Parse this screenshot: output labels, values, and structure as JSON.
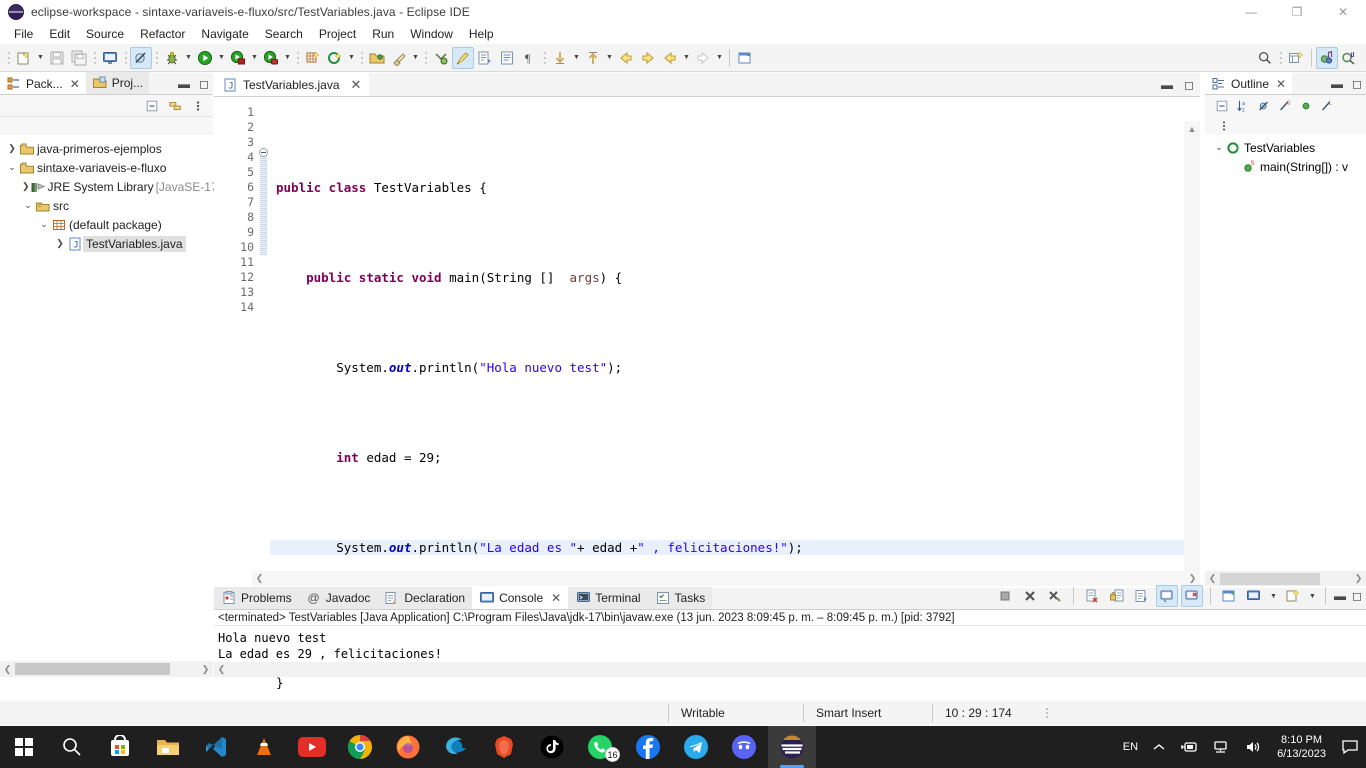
{
  "window": {
    "title": "eclipse-workspace - sintaxe-variaveis-e-fluxo/src/TestVariables.java - Eclipse IDE",
    "minimize": "—",
    "maximize": "❐",
    "close": "✕",
    "app_icon": "eclipse-sphere-icon"
  },
  "menubar": {
    "items": [
      "File",
      "Edit",
      "Source",
      "Refactor",
      "Navigate",
      "Search",
      "Project",
      "Run",
      "Window",
      "Help"
    ]
  },
  "toolbar": {
    "groups": [
      {
        "items": [
          {
            "name": "new-wizard-icon",
            "glyph": "📄",
            "dropdown": true,
            "selected": false
          },
          {
            "name": "save-icon",
            "glyph": "💾",
            "dropdown": false,
            "selected": false
          },
          {
            "name": "save-all-icon",
            "glyph": "🗎",
            "dropdown": false,
            "selected": false
          }
        ]
      },
      {
        "items": [
          {
            "name": "open-console-icon",
            "glyph": "🖥",
            "dropdown": false,
            "selected": false
          }
        ]
      },
      {
        "items": [
          {
            "name": "skip-all-breakpoints-icon",
            "glyph": "⊘",
            "dropdown": false,
            "selected": true
          }
        ]
      },
      {
        "items": [
          {
            "name": "debug-icon",
            "glyph": "🐞",
            "dropdown": true,
            "selected": false
          },
          {
            "name": "run-icon",
            "glyph": "▶",
            "dropdown": true,
            "selected": false
          },
          {
            "name": "coverage-icon",
            "glyph": "◉",
            "dropdown": true,
            "selected": false
          },
          {
            "name": "profile-icon",
            "glyph": "◉",
            "dropdown": true,
            "selected": false
          }
        ]
      },
      {
        "items": [
          {
            "name": "new-java-package-icon",
            "glyph": "▦",
            "dropdown": false,
            "selected": false
          },
          {
            "name": "new-java-class-icon",
            "glyph": "C",
            "dropdown": true,
            "selected": false
          }
        ]
      },
      {
        "items": [
          {
            "name": "open-type-icon",
            "glyph": "📂",
            "dropdown": false,
            "selected": false
          },
          {
            "name": "search-ref-icon",
            "glyph": "🔧",
            "dropdown": true,
            "selected": false
          }
        ]
      },
      {
        "items": [
          {
            "name": "previous-annotation-icon",
            "glyph": "⇩",
            "dropdown": false,
            "selected": false
          },
          {
            "name": "toggle-mark-occurrences-icon",
            "glyph": "🖌",
            "dropdown": false,
            "selected": true
          },
          {
            "name": "toggle-block-selection-icon",
            "glyph": "▤",
            "dropdown": false,
            "selected": false
          },
          {
            "name": "show-whitespace-icon",
            "glyph": "▥",
            "dropdown": false,
            "selected": false
          },
          {
            "name": "pilcrow-icon",
            "glyph": "¶",
            "dropdown": false,
            "selected": false
          }
        ]
      },
      {
        "items": [
          {
            "name": "next-annotation-icon",
            "glyph": "⇓",
            "dropdown": true,
            "selected": false
          },
          {
            "name": "prev-annotation-icon",
            "glyph": "⇑",
            "dropdown": true,
            "selected": false
          },
          {
            "name": "back-arrow-icon",
            "glyph": "⇦",
            "dropdown": false,
            "selected": false
          },
          {
            "name": "forward-arrow-icon",
            "glyph": "⇨",
            "dropdown": false,
            "selected": false
          },
          {
            "name": "back-history-icon",
            "glyph": "⇦",
            "dropdown": true,
            "selected": false
          },
          {
            "name": "forward-history-icon",
            "glyph": "⇨",
            "dropdown": true,
            "selected": false
          }
        ]
      },
      {
        "items": [
          {
            "name": "pin-editor-icon",
            "glyph": "🗗",
            "dropdown": false,
            "selected": false
          }
        ]
      }
    ],
    "right": [
      {
        "name": "quick-access-search-icon",
        "glyph": "🔍"
      },
      {
        "name": "open-perspective-icon",
        "glyph": "🗔"
      },
      {
        "name": "java-perspective-icon",
        "glyph": "J",
        "selected": true
      },
      {
        "name": "debug-perspective-icon",
        "glyph": "D",
        "selected": false
      }
    ]
  },
  "package_explorer": {
    "tabs": [
      {
        "label": "Pack...",
        "icon": "package-explorer-icon",
        "active": true,
        "closable": true
      },
      {
        "label": "Proj...",
        "icon": "project-explorer-icon",
        "active": false,
        "closable": false
      }
    ],
    "minimize": "▬",
    "maximize": "◻",
    "view_buttons": [
      {
        "name": "collapse-all-icon",
        "glyph": "⊟"
      },
      {
        "name": "link-with-editor-icon",
        "glyph": "⇄"
      },
      {
        "name": "view-menu-icon",
        "glyph": "⋮"
      }
    ],
    "tree": [
      {
        "indent": 0,
        "twisty": "collapsed",
        "icon": "project-folder-icon",
        "label": "java-primeros-ejemplos",
        "suffix": "",
        "selected": false
      },
      {
        "indent": 0,
        "twisty": "expanded",
        "icon": "project-folder-icon",
        "label": "sintaxe-variaveis-e-fluxo",
        "suffix": "",
        "selected": false
      },
      {
        "indent": 1,
        "twisty": "collapsed",
        "icon": "jre-library-icon",
        "label": "JRE System Library",
        "suffix": "[JavaSE-17",
        "selected": false
      },
      {
        "indent": 1,
        "twisty": "expanded",
        "icon": "source-folder-icon",
        "label": "src",
        "suffix": "",
        "selected": false
      },
      {
        "indent": 2,
        "twisty": "expanded",
        "icon": "package-icon",
        "label": "(default package)",
        "suffix": "",
        "selected": false
      },
      {
        "indent": 3,
        "twisty": "collapsed",
        "icon": "java-file-icon",
        "label": "TestVariables.java",
        "suffix": "",
        "selected": true
      }
    ],
    "hscroll": {
      "left_arrow": "❮",
      "right_arrow": "❯"
    }
  },
  "editor": {
    "tab": {
      "label": "TestVariables.java",
      "icon": "java-file-icon",
      "close": "✕"
    },
    "minimize": "▬",
    "maximize": "◻",
    "line_numbers": [
      "1",
      "2",
      "3",
      "4",
      "5",
      "6",
      "7",
      "8",
      "9",
      "10",
      "11",
      "12",
      "13",
      "14"
    ],
    "lines": [
      {
        "n": 1,
        "html": "",
        "highlight": false
      },
      {
        "n": 2,
        "html": "<span class='kw'>public class</span> TestVariables {",
        "highlight": false
      },
      {
        "n": 3,
        "html": "",
        "highlight": false
      },
      {
        "n": 4,
        "html": "    <span class='kw'>public static void</span> main(String []  <span class='par'>args</span>) {",
        "highlight": false
      },
      {
        "n": 5,
        "html": "",
        "highlight": false
      },
      {
        "n": 6,
        "html": "        System.<span class='fld'>out</span>.println(<span class='str'>\"Hola nuevo test\"</span>);",
        "highlight": false
      },
      {
        "n": 7,
        "html": "",
        "highlight": false
      },
      {
        "n": 8,
        "html": "        <span class='kw'>int</span> edad = 29;",
        "highlight": false
      },
      {
        "n": 9,
        "html": "",
        "highlight": false
      },
      {
        "n": 10,
        "html": "        System.<span class='fld'>out</span>.println(<span class='str'>\"La edad es \"</span>+ edad +<span class='str'>\" , felicitaciones!\"</span>);",
        "highlight": true
      },
      {
        "n": 11,
        "html": "    }",
        "highlight": false
      },
      {
        "n": 12,
        "html": "",
        "highlight": false
      },
      {
        "n": 13,
        "html": "}",
        "highlight": false
      },
      {
        "n": 14,
        "html": "",
        "highlight": false
      }
    ],
    "plain_text": "public class TestVariables {\n\n    public static void main(String []  args) {\n\n        System.out.println(\"Hola nuevo test\");\n\n        int edad = 29;\n\n        System.out.println(\"La edad es \"+ edad +\" , felicitaciones!\");\n    }\n\n}"
  },
  "outline": {
    "title": "Outline",
    "close": "✕",
    "minimize": "▬",
    "maximize": "◻",
    "toolbar": [
      {
        "name": "collapse-all-icon",
        "glyph": "⊟"
      },
      {
        "name": "sort-alphabetically-icon",
        "glyph": "↓ᵃz"
      },
      {
        "name": "hide-fields-icon",
        "glyph": "⊘"
      },
      {
        "name": "hide-static-icon",
        "glyph": "⊘ˢ"
      },
      {
        "name": "hide-nonpublic-icon",
        "glyph": "●"
      },
      {
        "name": "hide-local-types-icon",
        "glyph": "⊘ᴸ"
      },
      {
        "name": "view-menu-icon",
        "glyph": "⋮"
      }
    ],
    "tree": [
      {
        "indent": 0,
        "twisty": "expanded",
        "icon": "java-class-icon",
        "label": "TestVariables"
      },
      {
        "indent": 1,
        "twisty": "none",
        "icon": "public-method-icon",
        "label": "main(String[]) : v"
      }
    ]
  },
  "console": {
    "tabs": [
      {
        "label": "Problems",
        "icon": "problems-icon",
        "active": false,
        "closable": false
      },
      {
        "label": "Javadoc",
        "icon": "javadoc-icon",
        "active": false,
        "closable": false
      },
      {
        "label": "Declaration",
        "icon": "declaration-icon",
        "active": false,
        "closable": false
      },
      {
        "label": "Console",
        "icon": "console-icon",
        "active": true,
        "closable": true
      },
      {
        "label": "Terminal",
        "icon": "terminal-icon",
        "active": false,
        "closable": false
      },
      {
        "label": "Tasks",
        "icon": "tasks-icon",
        "active": false,
        "closable": false
      }
    ],
    "toolbar": [
      {
        "name": "terminate-icon",
        "glyph": "■",
        "selected": false
      },
      {
        "name": "remove-launch-icon",
        "glyph": "✖",
        "selected": false
      },
      {
        "name": "remove-all-terminated-icon",
        "glyph": "✖",
        "selected": false
      },
      {
        "name": "clear-console-icon",
        "glyph": "🗋",
        "selected": false
      },
      {
        "name": "scroll-lock-icon",
        "glyph": "🔒",
        "selected": false
      },
      {
        "name": "word-wrap-icon",
        "glyph": "🗎",
        "selected": false
      },
      {
        "name": "show-console-on-output-icon",
        "glyph": "🖵",
        "selected": true
      },
      {
        "name": "show-console-on-error-icon",
        "glyph": "🖵",
        "selected": true
      },
      {
        "name": "pin-console-icon",
        "glyph": "📌",
        "selected": false
      },
      {
        "name": "display-selected-console-icon",
        "glyph": "🖥",
        "selected": false,
        "dropdown": true
      },
      {
        "name": "open-console-icon",
        "glyph": "🗋",
        "selected": false,
        "dropdown": true
      },
      {
        "name": "minimize-icon",
        "glyph": "▬",
        "selected": false
      },
      {
        "name": "maximize-icon",
        "glyph": "◻",
        "selected": false
      }
    ],
    "header": "<terminated> TestVariables [Java Application] C:\\Program Files\\Java\\jdk-17\\bin\\javaw.exe  (13 jun. 2023 8:09:45 p. m. – 8:09:45 p. m.) [pid: 3792]",
    "output_lines": [
      "Hola nuevo test",
      "La edad es 29 , felicitaciones!"
    ]
  },
  "statusbar": {
    "writable": "Writable",
    "insert_mode": "Smart Insert",
    "position": "10 : 29 : 174"
  },
  "taskbar": {
    "items": [
      {
        "name": "start-button-icon",
        "glyph": "⊞",
        "active": false,
        "badge": null
      },
      {
        "name": "search-icon",
        "glyph": "🔍",
        "active": false,
        "badge": null
      },
      {
        "name": "microsoft-store-icon",
        "glyph": "🛍",
        "active": false,
        "badge": null
      },
      {
        "name": "file-explorer-icon",
        "glyph": "📁",
        "active": false,
        "badge": null
      },
      {
        "name": "vscode-icon",
        "glyph": "X",
        "active": false,
        "badge": null
      },
      {
        "name": "vlc-icon",
        "glyph": "▲",
        "active": false,
        "badge": null
      },
      {
        "name": "youtube-icon",
        "glyph": "▶",
        "active": false,
        "badge": null
      },
      {
        "name": "chrome-icon",
        "glyph": "◉",
        "active": false,
        "badge": null
      },
      {
        "name": "firefox-icon",
        "glyph": "🦊",
        "active": false,
        "badge": null
      },
      {
        "name": "edge-icon",
        "glyph": "◉",
        "active": false,
        "badge": null
      },
      {
        "name": "brave-icon",
        "glyph": "🦁",
        "active": false,
        "badge": null
      },
      {
        "name": "tiktok-icon",
        "glyph": "♪",
        "active": false,
        "badge": null
      },
      {
        "name": "whatsapp-icon",
        "glyph": "✆",
        "active": false,
        "badge": "16"
      },
      {
        "name": "facebook-icon",
        "glyph": "f",
        "active": false,
        "badge": null
      },
      {
        "name": "telegram-icon",
        "glyph": "➤",
        "active": false,
        "badge": null
      },
      {
        "name": "discord-icon",
        "glyph": "◕",
        "active": false,
        "badge": null
      },
      {
        "name": "eclipse-icon",
        "glyph": "⬤",
        "active": true,
        "badge": null
      }
    ],
    "tray": {
      "language": "EN",
      "chevron": "︿",
      "items": [
        {
          "name": "hidden-icons-chevron-icon",
          "glyph": "︿"
        },
        {
          "name": "usb-device-icon",
          "glyph": "🖭"
        },
        {
          "name": "network-icon",
          "glyph": "🖧"
        },
        {
          "name": "volume-icon",
          "glyph": "🔊"
        }
      ],
      "time": "8:10 PM",
      "date": "6/13/2023",
      "notifications": "💬"
    }
  },
  "colors": {
    "eclipse_purple": "#2c1e4f",
    "keyword": "#7f0055",
    "string": "#2a00ff",
    "field": "#0000c0",
    "param": "#6a3e3e",
    "highlight_line": "#e8f0fb",
    "taskbar_bg": "#1f1f1f",
    "toolbar_bg": "#f4f4f4",
    "selected_tab": "#d7e9f7"
  }
}
